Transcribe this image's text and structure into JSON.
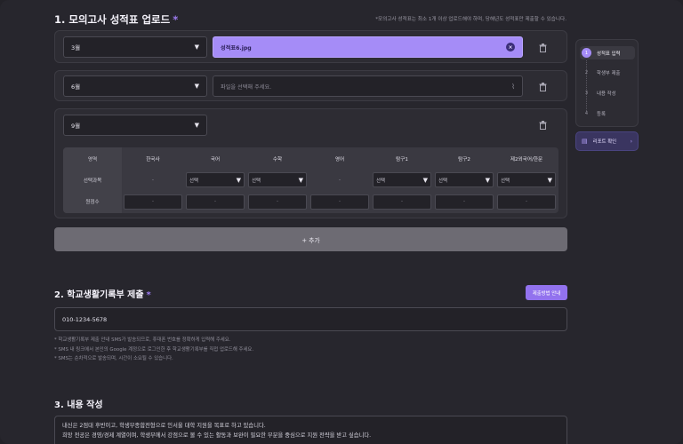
{
  "section1": {
    "title": "1. 모의고사 성적표 업로드",
    "required_mark": "*",
    "note": "*모의고사 성적표는 최소 1개 이상 업로드해야 하며, 당해년도 성적표만 제출할 수 있습니다.",
    "rows": [
      {
        "month": "3월",
        "file": "성적표6.jpg",
        "filled": true
      },
      {
        "month": "6월",
        "file_placeholder": "파일을 선택해 주세요.",
        "filled": false
      },
      {
        "month": "9월"
      }
    ],
    "table": {
      "header_label": "영역",
      "columns": [
        "한국사",
        "국어",
        "수학",
        "영어",
        "탐구1",
        "탐구2",
        "제2외국어/한문"
      ],
      "row1_label": "선택과목",
      "row1": [
        "-",
        "선택",
        "선택",
        "-",
        "선택",
        "선택",
        "선택"
      ],
      "row2_label": "원점수",
      "row2": [
        "-",
        "-",
        "-",
        "-",
        "-",
        "-",
        "-"
      ]
    },
    "add_label": "+ 추가"
  },
  "stepper": {
    "steps": [
      {
        "num": "1",
        "label": "성적표 입력"
      },
      {
        "num": "2",
        "label": "학생부 제출"
      },
      {
        "num": "3",
        "label": "내용 작성"
      },
      {
        "num": "4",
        "label": "등록"
      }
    ],
    "report_label": "리포트 확인",
    "report_chevron": "›"
  },
  "section2": {
    "title": "2. 학교생활기록부 제출",
    "required_mark": "*",
    "guide_button": "제출방법 안내",
    "phone_value": "010-1234-5678",
    "notes": [
      "* 학교생활기록부 제출 안내 SMS가 발송되므로, 휴대폰 번호를 정확하게 입력해 주세요.",
      "* SMS 내 링크에서 본인의 Google 계정으로 로그인한 후 학교생활기록부를 직접 업로드해 주세요.",
      "* SMS는 순차적으로 발송되며, 시간이 소요될 수 있습니다."
    ]
  },
  "section3": {
    "title": "3. 내용 작성",
    "lines": [
      "내신은 2점대 후반이고, 학생부종합전형으로 인서울 대학 지원을 목표로 하고 있습니다.",
      "희망 전공은 경영/경제 계열이며, 학생부에서 강점으로 볼 수 있는 활동과 보완이 필요한 부분을 중심으로 지원 전략을 받고 싶습니다."
    ]
  },
  "icons": {
    "caret": "▼",
    "close": "×",
    "clip": "⌇",
    "report": "▤"
  },
  "colors": {
    "accent": "#a58cf7",
    "button": "#9272ee",
    "background": "#27262d"
  }
}
